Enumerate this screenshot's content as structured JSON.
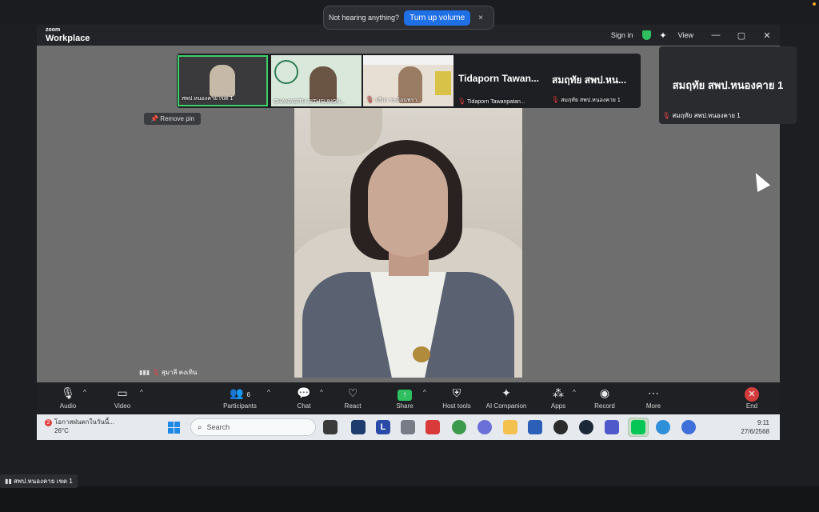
{
  "notification": {
    "message": "Not hearing anything?",
    "button": "Turn up volume",
    "close": "×"
  },
  "app": {
    "logo_top": "zoom",
    "logo_bottom": "Workplace"
  },
  "titlebar": {
    "sign_in": "Sign in",
    "view": "View",
    "minimize": "—",
    "maximize": "▢",
    "close": "✕"
  },
  "thumbnails": [
    {
      "caption": "สพป.หนองคาย เขต 1"
    },
    {
      "caption": "CHANASITH SITHSUNGN..."
    },
    {
      "caption": "ปรียา ชะอ้อนพรา..."
    },
    {
      "big": "Tidaporn  Tawan...",
      "caption": "Tidaporn Tawanpatan..."
    },
    {
      "big": "สมฤทัย  สพป.หน...",
      "caption": "สมฤทัย สพป.หนองคาย 1"
    }
  ],
  "active_speaker": {
    "big": "สมฤทัย สพป.หนองคาย 1",
    "caption": "สมฤทัย สพป.หนองคาย 1"
  },
  "remove_pin": "Remove pin",
  "network_label": "สุมาลี คงเทิน",
  "controls": {
    "audio": "Audio",
    "video": "Video",
    "participants": "Participants",
    "participants_count": "6",
    "chat": "Chat",
    "react": "React",
    "share": "Share",
    "host_tools": "Host tools",
    "ai_companion": "AI Companion",
    "apps": "Apps",
    "record": "Record",
    "more": "More",
    "end": "End"
  },
  "taskbar": {
    "weather_badge": "2",
    "weather_text": "โอกาสฝนตกในวันนี้...",
    "temperature": "26°C",
    "search_placeholder": "Search",
    "time": "9:11",
    "date": "27/6/2568"
  },
  "bottom_label": "สพป.หนองคาย เขต 1"
}
